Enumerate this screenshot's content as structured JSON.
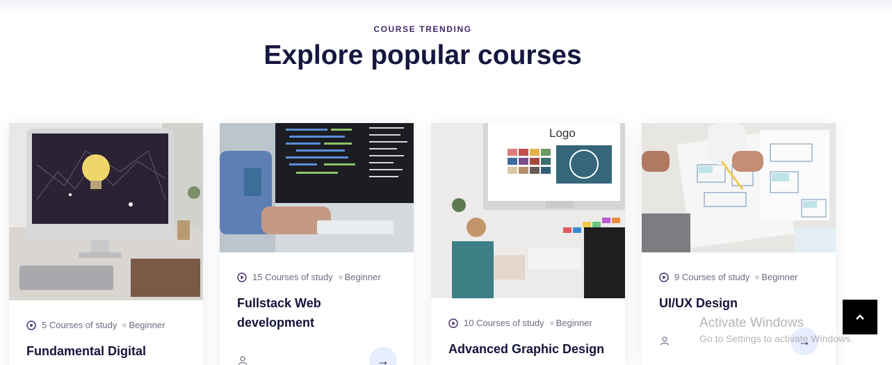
{
  "section": {
    "eyebrow": "COURSE TRENDING",
    "heading": "Explore popular courses"
  },
  "courses": [
    {
      "lessons": "5 Courses of study",
      "level": "Beginner",
      "title": "Fundamental Digital",
      "image": "desktop-lightbulb-photo"
    },
    {
      "lessons": "15 Courses of study",
      "level": "Beginner",
      "title": "Fullstack Web development",
      "image": "coding-monitor-photo"
    },
    {
      "lessons": "10 Courses of study",
      "level": "Beginner",
      "title": "Advanced Graphic Design",
      "image": "color-swatches-photo"
    },
    {
      "lessons": "9 Courses of study",
      "level": "Beginner",
      "title": "UI/UX Design",
      "image": "wireframe-sketch-photo"
    }
  ],
  "icons": {
    "play": "play-circle-icon",
    "user": "user-icon",
    "arrow": "arrow-right-icon",
    "scroll_top": "chevron-up-icon"
  },
  "overlay": {
    "watermark_line1": "Activate Windows",
    "watermark_line2": "Go to Settings to activate Windows."
  },
  "colors": {
    "heading": "#16163f",
    "eyebrow": "#3f2a6b",
    "arrow_button_bg": "#e8edff",
    "scroll_top_bg": "#000000"
  }
}
